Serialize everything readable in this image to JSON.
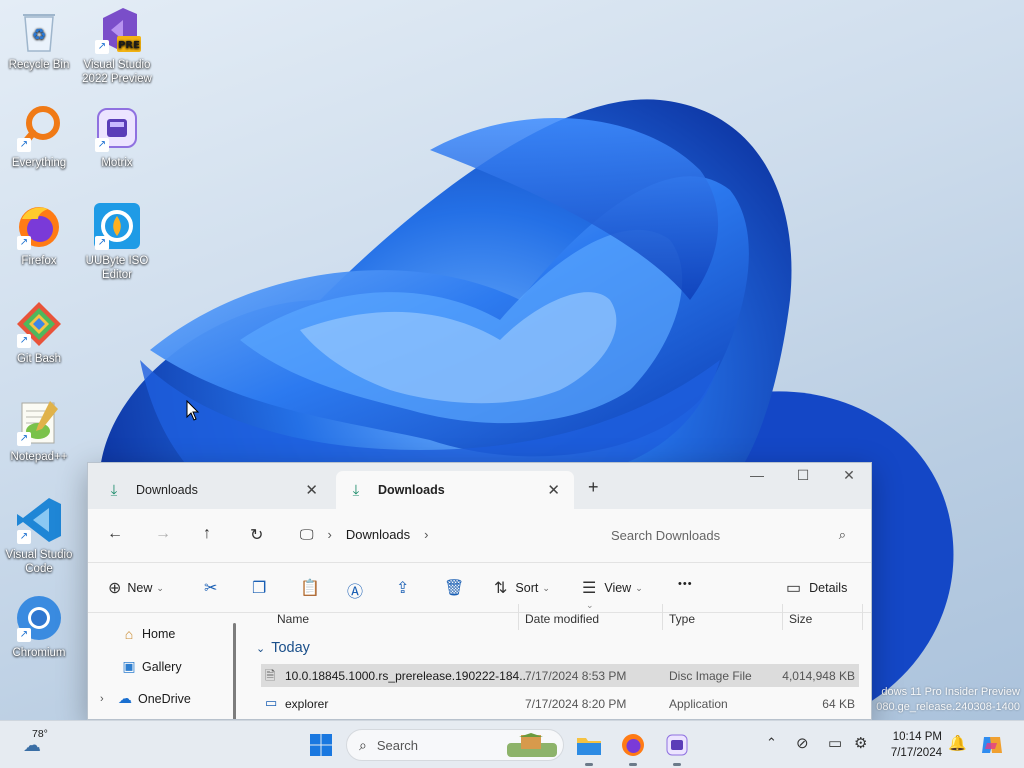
{
  "desktop": {
    "icons": [
      {
        "label": "Recycle Bin",
        "icon": "recycle-bin-icon"
      },
      {
        "label": "Visual Studio 2022 Preview",
        "badge": "PRE",
        "icon": "visual-studio-preview-icon"
      },
      {
        "label": "Everything",
        "icon": "everything-search-icon"
      },
      {
        "label": "Motrix",
        "icon": "motrix-icon"
      },
      {
        "label": "Firefox",
        "icon": "firefox-icon"
      },
      {
        "label": "UUByte ISO Editor",
        "icon": "uubyte-iso-editor-icon"
      },
      {
        "label": "Git Bash",
        "icon": "git-bash-icon"
      },
      {
        "label": "Notepad++",
        "icon": "notepad-plus-plus-icon"
      },
      {
        "label": "Visual Studio Code",
        "icon": "vscode-icon"
      },
      {
        "label": "Chromium",
        "icon": "chromium-icon"
      }
    ],
    "watermark": [
      "dows 11 Pro Insider Preview",
      "080.ge_release.240308-1400"
    ]
  },
  "explorer": {
    "tabs": [
      {
        "label": "Downloads",
        "active": false
      },
      {
        "label": "Downloads",
        "active": true
      }
    ],
    "new_tab": "+",
    "window_controls": {
      "minimize": "—",
      "maximize": "☐",
      "close": "✕"
    },
    "breadcrumb": {
      "location": "Downloads"
    },
    "search_placeholder": "Search Downloads",
    "commands": {
      "new": "New",
      "sort": "Sort",
      "view": "View",
      "more": "•••",
      "details": "Details"
    },
    "nav_pane": [
      {
        "label": "Home",
        "icon": "home-icon"
      },
      {
        "label": "Gallery",
        "icon": "gallery-icon"
      },
      {
        "label": "OneDrive",
        "icon": "onedrive-icon"
      }
    ],
    "columns": {
      "name": "Name",
      "date": "Date modified",
      "type": "Type",
      "size": "Size"
    },
    "group_label": "Today",
    "files": [
      {
        "name": "10.0.18845.1000.rs_prerelease.190222-184...",
        "date": "7/17/2024 8:53 PM",
        "type": "Disc Image File",
        "size": "4,014,948 KB",
        "selected": true
      },
      {
        "name": "explorer",
        "date": "7/17/2024 8:20 PM",
        "type": "Application",
        "size": "64 KB",
        "selected": false
      }
    ]
  },
  "taskbar": {
    "weather_temp": "78°",
    "search_label": "Search",
    "time": "10:14 PM",
    "date": "7/17/2024"
  },
  "colors": {
    "accent": "#1a5fb4",
    "bloom_blue": "#1b63e0",
    "selection": "#dcdcdc"
  }
}
